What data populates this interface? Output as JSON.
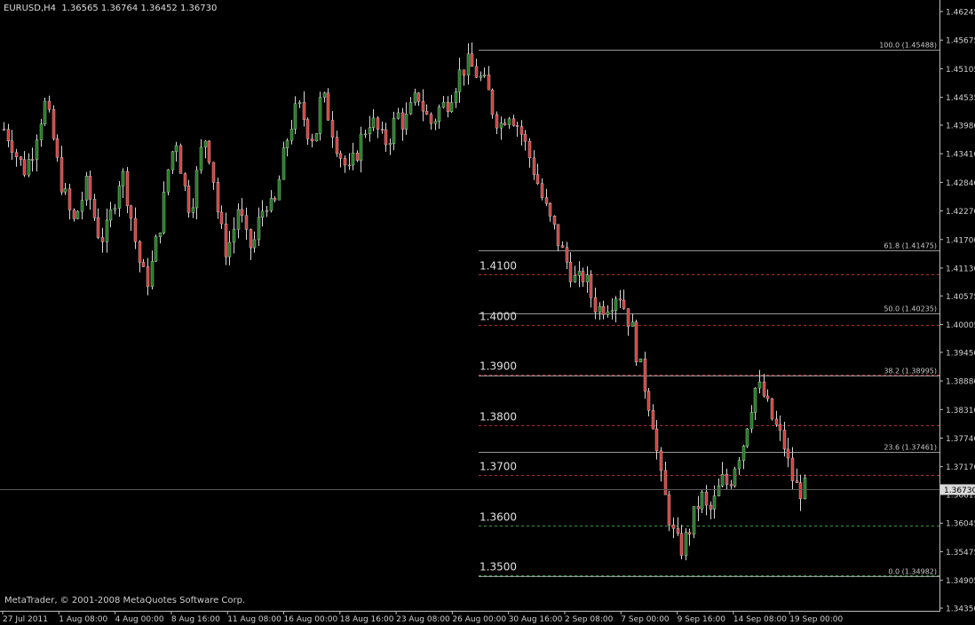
{
  "header": {
    "symbol_timeframe": "EURUSD,H4",
    "ohlc": "1.36565 1.36764 1.36452 1.36730"
  },
  "footer": {
    "copyright": "MetaTrader, © 2001-2008 MetaQuotes Software Corp."
  },
  "colors": {
    "background": "#000000",
    "bull_candle": "#1a7a1a",
    "bear_candle": "#d23c3c",
    "wick": "#d8d8d8",
    "fib_line": "#c8c8c8",
    "level_red": "#b03030",
    "level_green": "#3a9a3a",
    "axis_text": "#cfcfcf"
  },
  "chart_data": {
    "type": "candlestick",
    "symbol": "EURUSD",
    "timeframe": "H4",
    "last_price": "1.36730",
    "ylim": [
      1.343,
      1.463
    ],
    "price_ticks": [
      "1.46245",
      "1.45675",
      "1.45105",
      "1.44535",
      "1.43980",
      "1.43410",
      "1.42840",
      "1.42270",
      "1.41700",
      "1.41130",
      "1.40575",
      "1.40005",
      "1.39450",
      "1.38880",
      "1.38310",
      "1.37740",
      "1.37170",
      "1.36615",
      "1.36045",
      "1.35475",
      "1.34905",
      "1.34350"
    ],
    "time_ticks": [
      "27 Jul 2011",
      "1 Aug 08:00",
      "4 Aug 00:00",
      "8 Aug 16:00",
      "11 Aug 08:00",
      "16 Aug 00:00",
      "18 Aug 16:00",
      "23 Aug 08:00",
      "26 Aug 00:00",
      "30 Aug 16:00",
      "2 Sep 08:00",
      "7 Sep 00:00",
      "9 Sep 16:00",
      "14 Sep 08:00",
      "19 Sep 00:00"
    ],
    "fib_levels": [
      {
        "label": "100.0 (1.45488)",
        "price": 1.45488
      },
      {
        "label": "61.8 (1.41475)",
        "price": 1.41475
      },
      {
        "label": "50.0 (1.40235)",
        "price": 1.40235
      },
      {
        "label": "38.2 (1.38995)",
        "price": 1.38995
      },
      {
        "label": "23.6 (1.37461)",
        "price": 1.37461
      },
      {
        "label": "0.0 (1.34982)",
        "price": 1.34982
      }
    ],
    "price_levels": [
      {
        "label": "1.4100",
        "price": 1.41,
        "color": "red"
      },
      {
        "label": "1.4000",
        "price": 1.4,
        "color": "red"
      },
      {
        "label": "1.3900",
        "price": 1.39,
        "color": "red"
      },
      {
        "label": "1.3800",
        "price": 1.38,
        "color": "red"
      },
      {
        "label": "1.3700",
        "price": 1.37,
        "color": "red"
      },
      {
        "label": "1.3600",
        "price": 1.36,
        "color": "green"
      },
      {
        "label": "1.3500",
        "price": 1.35,
        "color": "green"
      }
    ],
    "close_path": [
      1.439,
      1.437,
      1.433,
      1.431,
      1.434,
      1.44,
      1.444,
      1.438,
      1.43,
      1.425,
      1.42,
      1.424,
      1.428,
      1.422,
      1.417,
      1.419,
      1.425,
      1.431,
      1.425,
      1.417,
      1.41,
      1.409,
      1.416,
      1.423,
      1.433,
      1.437,
      1.428,
      1.423,
      1.43,
      1.438,
      1.433,
      1.422,
      1.415,
      1.417,
      1.424,
      1.417,
      1.415,
      1.421,
      1.425,
      1.422,
      1.43,
      1.437,
      1.442,
      1.443,
      1.439,
      1.437,
      1.446,
      1.442,
      1.437,
      1.433,
      1.43,
      1.434,
      1.438,
      1.441,
      1.439,
      1.436,
      1.438,
      1.442,
      1.44,
      1.443,
      1.446,
      1.442,
      1.44,
      1.443,
      1.444,
      1.447,
      1.45,
      1.452,
      1.451,
      1.449,
      1.447,
      1.442,
      1.44,
      1.443,
      1.441,
      1.438,
      1.434,
      1.43,
      1.425,
      1.421,
      1.418,
      1.414,
      1.411,
      1.408,
      1.41,
      1.406,
      1.403,
      1.404,
      1.405,
      1.407,
      1.403,
      1.399,
      1.392,
      1.387,
      1.381,
      1.37,
      1.364,
      1.358,
      1.355,
      1.358,
      1.362,
      1.366,
      1.362,
      1.365,
      1.369,
      1.368,
      1.373,
      1.376,
      1.383,
      1.388,
      1.386,
      1.382,
      1.379,
      1.376,
      1.37,
      1.367,
      1.3673
    ]
  }
}
